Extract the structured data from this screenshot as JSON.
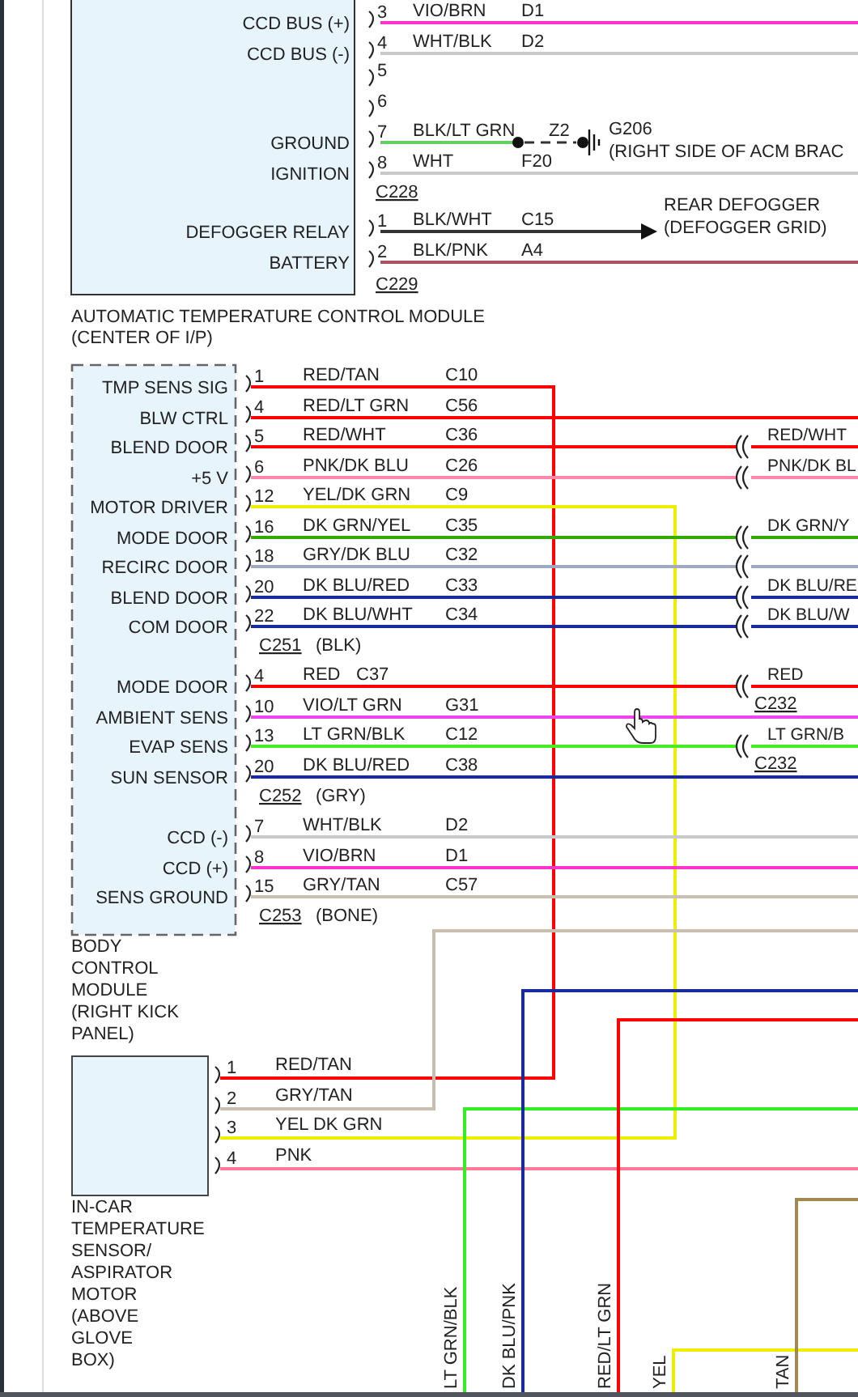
{
  "atc_module": {
    "caption": [
      "AUTOMATIC TEMPERATURE CONTROL MODULE",
      "(CENTER OF I/P)"
    ],
    "connectors": [
      {
        "name": "C228",
        "pins": [
          {
            "function": "CCD BUS (+)",
            "pin": "3",
            "wire": "VIO/BRN",
            "circuit": "D1",
            "color": "#ff33cc",
            "kind": "edge"
          },
          {
            "function": "CCD BUS (-)",
            "pin": "4",
            "wire": "WHT/BLK",
            "circuit": "D2",
            "color": "#c8c8c8",
            "kind": "edge"
          },
          {
            "pin": "5",
            "kind": "empty"
          },
          {
            "pin": "6",
            "kind": "empty"
          },
          {
            "function": "GROUND",
            "pin": "7",
            "wire": "BLK/LT GRN",
            "circuit": "Z2",
            "color": "#66cc66",
            "kind": "ground"
          },
          {
            "function": "IGNITION",
            "pin": "8",
            "wire": "WHT",
            "circuit": "F20",
            "color": "#c8c8c8",
            "kind": "edge"
          }
        ]
      },
      {
        "name": "C229",
        "pins": [
          {
            "function": "DEFOGGER RELAY",
            "pin": "1",
            "wire": "BLK/WHT",
            "circuit": "C15",
            "color": "#333333",
            "kind": "arrow"
          },
          {
            "function": "BATTERY",
            "pin": "2",
            "wire": "BLK/PNK",
            "circuit": "A4",
            "color": "#b05060",
            "kind": "edge"
          }
        ]
      }
    ]
  },
  "ground": {
    "name": "G206",
    "location": "(RIGHT SIDE OF ACM BRAC"
  },
  "defogger": [
    "REAR DEFOGGER",
    "(DEFOGGER GRID)"
  ],
  "bcm": {
    "caption": [
      "BODY",
      "CONTROL",
      "MODULE",
      "(RIGHT KICK",
      "PANEL)"
    ],
    "connectors": [
      {
        "name": "C251",
        "color_name": "(BLK)",
        "pins": [
          {
            "function": "TMP SENS SIG",
            "pin": "1",
            "wire": "RED/TAN",
            "circuit": "C10",
            "color": "#ff0000",
            "kind": "sensor"
          },
          {
            "function": "BLW CTRL",
            "pin": "4",
            "wire": "RED/LT GRN",
            "circuit": "C56",
            "color": "#ff0000",
            "kind": "edge"
          },
          {
            "function": "BLEND DOOR",
            "pin": "5",
            "wire": "RED/WHT",
            "circuit": "C36",
            "color": "#ff0000",
            "kind": "splice",
            "far_label": "RED/WHT"
          },
          {
            "function": "+5 V",
            "pin": "6",
            "wire": "PNK/DK BLU",
            "circuit": "C26",
            "color": "#ff88aa",
            "kind": "splice",
            "far_label": "PNK/DK BL"
          },
          {
            "function": "MOTOR DRIVER",
            "pin": "12",
            "wire": "YEL/DK GRN",
            "circuit": "C9",
            "color": "#eeee00",
            "kind": "sensor"
          },
          {
            "function": "MODE DOOR",
            "pin": "16",
            "wire": "DK GRN/YEL",
            "circuit": "C35",
            "color": "#33aa00",
            "kind": "splice",
            "far_label": "DK GRN/Y"
          },
          {
            "function": "RECIRC DOOR",
            "pin": "18",
            "wire": "GRY/DK BLU",
            "circuit": "C32",
            "color": "#a0a8c0",
            "kind": "splice"
          },
          {
            "function": "BLEND DOOR",
            "pin": "20",
            "wire": "DK BLU/RED",
            "circuit": "C33",
            "color": "#1a2a9a",
            "kind": "splice",
            "far_label": "DK BLU/RE"
          },
          {
            "function": "COM DOOR",
            "pin": "22",
            "wire": "DK BLU/WHT",
            "circuit": "C34",
            "color": "#1a2a9a",
            "kind": "splice",
            "far_label": "DK BLU/W"
          }
        ]
      },
      {
        "name": "C252",
        "color_name": "(GRY)",
        "pins": [
          {
            "function": "MODE DOOR",
            "pin": "4",
            "wire": "RED",
            "circuit": "C37",
            "color": "#ff0000",
            "kind": "splice",
            "far_label": "RED",
            "splice_name": "C232"
          },
          {
            "function": "AMBIENT SENS",
            "pin": "10",
            "wire": "VIO/LT GRN",
            "circuit": "G31",
            "color": "#ee44ee",
            "kind": "edge"
          },
          {
            "function": "EVAP SENS",
            "pin": "13",
            "wire": "LT GRN/BLK",
            "circuit": "C12",
            "color": "#44ee22",
            "kind": "splice",
            "far_label": "LT GRN/B",
            "splice_name": "C232"
          },
          {
            "function": "SUN SENSOR",
            "pin": "20",
            "wire": "DK BLU/RED",
            "circuit": "C38",
            "color": "#1a2a9a",
            "kind": "edge"
          }
        ]
      },
      {
        "name": "C253",
        "color_name": "(BONE)",
        "pins": [
          {
            "function": "CCD (-)",
            "pin": "7",
            "wire": "WHT/BLK",
            "circuit": "D2",
            "color": "#c8c8c8",
            "kind": "edge"
          },
          {
            "function": "CCD (+)",
            "pin": "8",
            "wire": "VIO/BRN",
            "circuit": "D1",
            "color": "#ff33cc",
            "kind": "edge"
          },
          {
            "function": "SENS GROUND",
            "pin": "15",
            "wire": "GRY/TAN",
            "circuit": "C57",
            "color": "#c8bfb0",
            "kind": "edge"
          }
        ]
      }
    ]
  },
  "sensor": {
    "caption": [
      "IN-CAR",
      "TEMPERATURE",
      "SENSOR/",
      "ASPIRATOR",
      "MOTOR",
      "(ABOVE",
      "GLOVE",
      "BOX)"
    ],
    "pins": [
      {
        "pin": "1",
        "wire": "RED/TAN",
        "kind": "linked"
      },
      {
        "pin": "2",
        "wire": "GRY/TAN",
        "color": "#c8bfb0",
        "kind": "bend"
      },
      {
        "pin": "3",
        "wire": "YEL DK GRN",
        "kind": "linked"
      },
      {
        "pin": "4",
        "wire": "PNK",
        "color": "#ff7799",
        "kind": "edge"
      }
    ]
  },
  "harness_wires": [
    {
      "wire": "LT GRN/BLK",
      "color": "#33ee22"
    },
    {
      "wire": "DK BLU/PNK",
      "color": "#1a2a9a"
    },
    {
      "wire": "RED/LT GRN",
      "color": "#ff0000"
    },
    {
      "wire": "YEL",
      "color": "#eeee00"
    },
    {
      "wire": "TAN",
      "color": "#a08850"
    }
  ]
}
